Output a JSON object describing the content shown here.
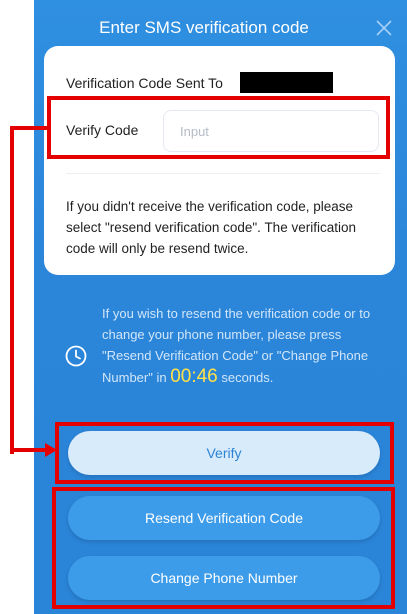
{
  "dialog": {
    "title": "Enter SMS verification code",
    "close_icon": "close-icon"
  },
  "card": {
    "sent_to_label": "Verification Code Sent To",
    "verify_code_label": "Verify Code",
    "input_placeholder": "Input",
    "input_value": "",
    "info_text": "If you didn't receive the verification code, please select \"resend verification code\". The verification code will only be resend twice."
  },
  "resend_hint": {
    "icon": "clock-icon",
    "text_before": "If you wish to resend the verification code or to change your phone number, please press \"Resend Verification Code\" or \"Change Phone Number\" in ",
    "countdown": "00:46",
    "text_after": " seconds."
  },
  "buttons": {
    "verify": "Verify",
    "resend": "Resend Verification Code",
    "change_phone": "Change Phone Number"
  },
  "colors": {
    "panel_blue": "#2b86da",
    "button_blue": "#3d9cea",
    "verify_button_bg": "#d8ebfb",
    "countdown_yellow": "#ffe14a",
    "annotation_red": "#e40000"
  }
}
